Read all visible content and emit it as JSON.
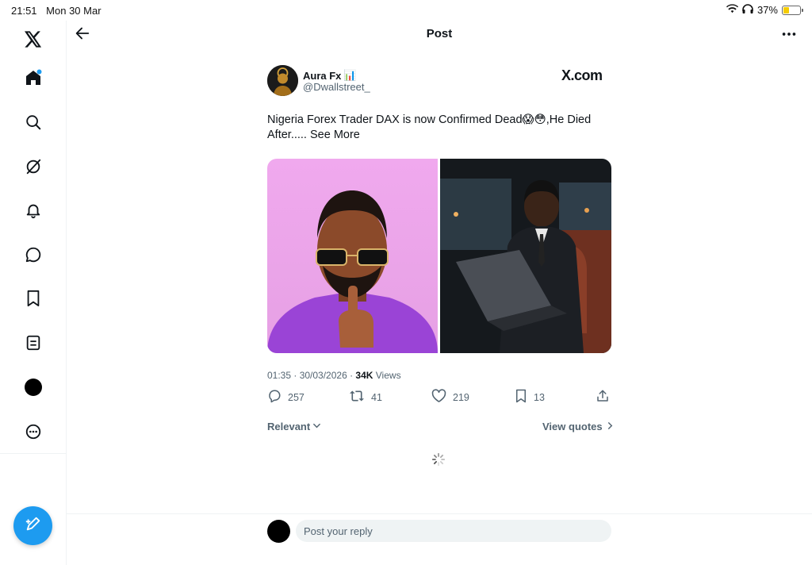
{
  "status_bar": {
    "time": "21:51",
    "date": "Mon 30 Mar",
    "battery": "37%",
    "battery_level": 0.37
  },
  "sidebar": {
    "items": [
      {
        "icon": "x-logo-icon"
      },
      {
        "icon": "home-icon",
        "notification_dot": true
      },
      {
        "icon": "search-icon"
      },
      {
        "icon": "grok-icon"
      },
      {
        "icon": "bell-icon"
      },
      {
        "icon": "chat-bubble-icon"
      },
      {
        "icon": "bookmark-icon"
      },
      {
        "icon": "list-icon"
      },
      {
        "icon": "profile-avatar"
      },
      {
        "icon": "more-circle-icon"
      }
    ],
    "compose_icon": "compose-feather-icon"
  },
  "header": {
    "title": "Post"
  },
  "post": {
    "author_name": "Aura Fx",
    "author_emoji": "📊",
    "handle": "@Dwallstreet_",
    "brand_text": "X.com",
    "text": "Nigeria Forex Trader DAX is now Confirmed Dead😱😳,He Died After..... ",
    "see_more": "See More",
    "timestamp": "01:35 · 30/03/2026 · ",
    "views_count": "34K",
    "views_label": " Views",
    "replies": "257",
    "reposts": "41",
    "likes": "219",
    "bookmarks": "13"
  },
  "replies_section": {
    "sort_label": "Relevant",
    "view_quotes_label": "View quotes"
  },
  "reply_box": {
    "placeholder": "Post your reply"
  },
  "colors": {
    "accent": "#1d9bf0",
    "text_primary": "#0f1419",
    "text_secondary": "#536471",
    "divider": "#eff3f4"
  }
}
